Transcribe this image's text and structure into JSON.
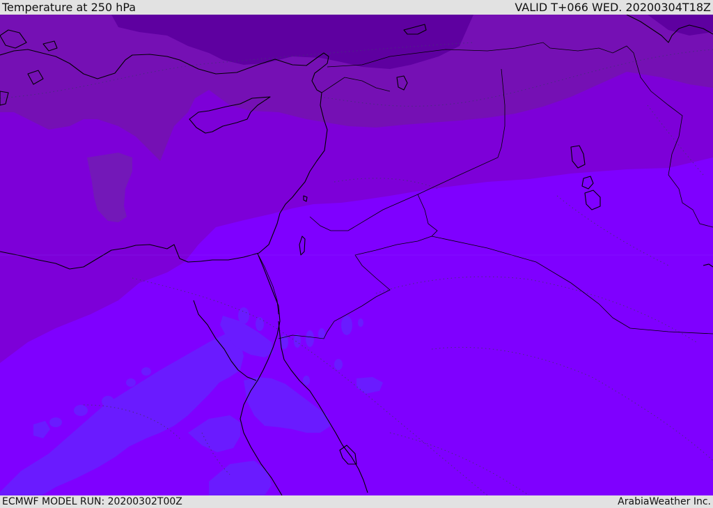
{
  "header": {
    "title": "Temperature at 250 hPa",
    "valid": "VALID T+066 WED. 20200304T18Z"
  },
  "footer": {
    "model_run": "ECMWF MODEL RUN: 20200302T00Z",
    "credit": "ArabiaWeather Inc."
  },
  "colors": {
    "deep_north": "#5e00a0",
    "north": "#7510b4",
    "mid": "#7d00d8",
    "south": "#7f00ff",
    "warm_patch": "#6a1bff",
    "coast": "#000000",
    "isotherm_dotted": "#4a2b80",
    "frame_bg": "#e2e2e2"
  }
}
